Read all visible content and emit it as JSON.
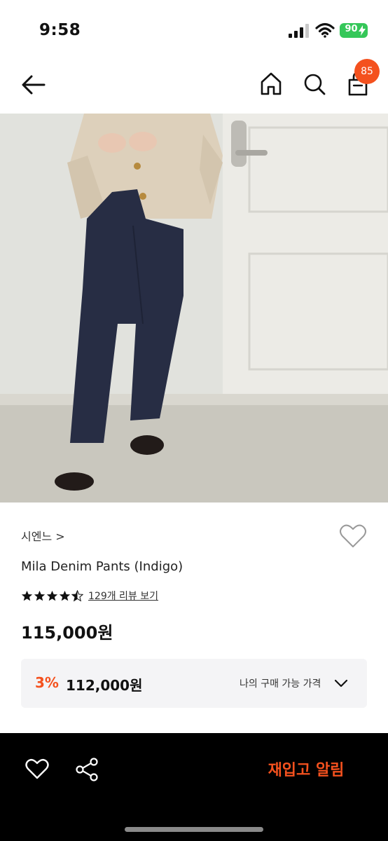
{
  "status_bar": {
    "time": "9:58",
    "battery": "90",
    "icons": [
      "signal-icon",
      "wifi-icon",
      "battery-icon"
    ],
    "battery_color": "#35c759"
  },
  "nav": {
    "icons": [
      "back-arrow-icon",
      "home-icon",
      "search-icon",
      "shopping-bag-icon"
    ],
    "cart_count": "85",
    "badge_color": "#f4511e"
  },
  "product": {
    "brand": "시엔느 >",
    "title": "Mila Denim Pants (Indigo)",
    "rating": 4.5,
    "review_link": "129개 리뷰 보기",
    "price": "115,000원",
    "offer": {
      "discount_rate": "3%",
      "price": "112,000원",
      "label": "나의 구매 가능 가격"
    }
  },
  "bottom_bar": {
    "icons": [
      "heart-icon",
      "share-icon"
    ],
    "restock_label": "재입고 알림",
    "accent": "#f4511e"
  }
}
